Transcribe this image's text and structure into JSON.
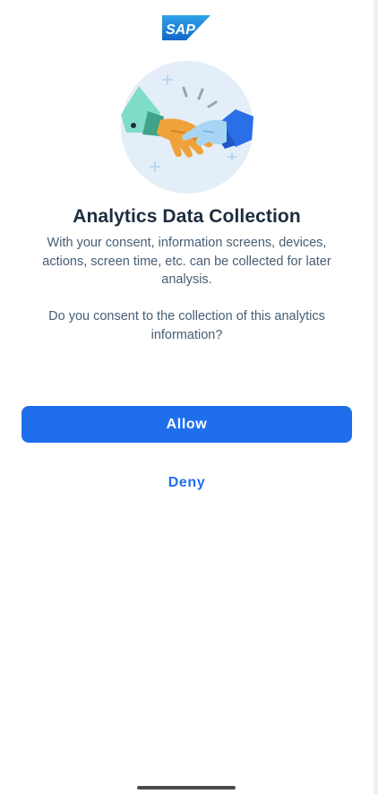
{
  "brand": {
    "logo_text": "SAP",
    "logo_icon": "sap-logo",
    "color": "#1f6fec"
  },
  "illustration": {
    "icon": "handshake-icon"
  },
  "consent": {
    "title": "Analytics Data Collection",
    "description": "With your consent, information screens, devices, actions, screen time, etc. can be collected for later analysis.",
    "question": "Do you consent to the collection of this analytics information?"
  },
  "actions": {
    "allow_label": "Allow",
    "deny_label": "Deny",
    "primary_color": "#1f6fec"
  }
}
